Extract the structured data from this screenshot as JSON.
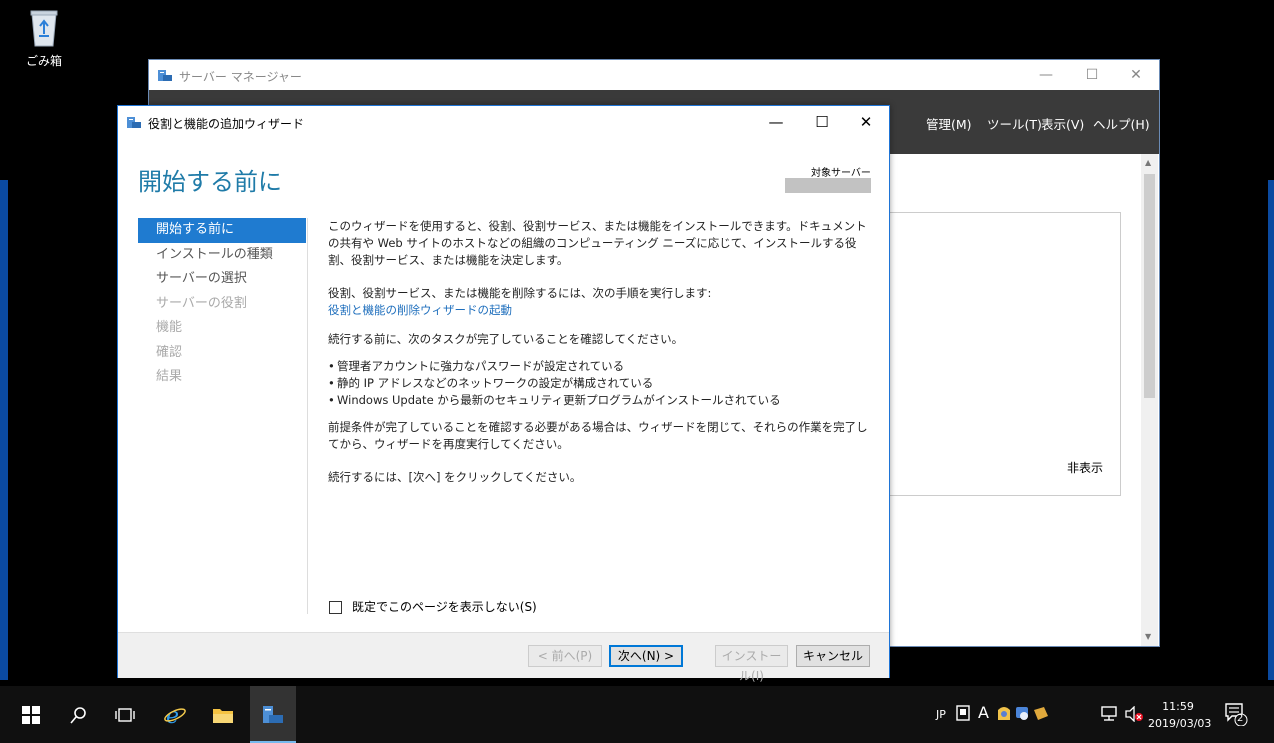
{
  "desktop": {
    "recycle_bin_label": "ごみ箱"
  },
  "server_manager": {
    "title": "サーバー マネージャー",
    "menus": [
      "管理(M)",
      "ツール(T)",
      "表示(V)",
      "ヘルプ(H)"
    ],
    "hide_label": "非表示"
  },
  "wizard": {
    "title": "役割と機能の追加ウィザード",
    "heading": "開始する前に",
    "destination_label": "対象サーバー",
    "nav": [
      "開始する前に",
      "インストールの種類",
      "サーバーの選択",
      "サーバーの役割",
      "機能",
      "確認",
      "結果"
    ],
    "intro": "このウィザードを使用すると、役割、役割サービス、または機能をインストールできます。ドキュメントの共有や Web サイトのホストなどの組織のコンピューティング ニーズに応じて、インストールする役割、役割サービス、または機能を決定します。",
    "remove_text": "役割、役割サービス、または機能を削除するには、次の手順を実行します:",
    "remove_link": "役割と機能の削除ウィザードの起動",
    "before_text": "続行する前に、次のタスクが完了していることを確認してください。",
    "tasks": [
      "管理者アカウントに強力なパスワードが設定されている",
      "静的 IP アドレスなどのネットワークの設定が構成されている",
      "Windows Update から最新のセキュリティ更新プログラムがインストールされている"
    ],
    "prereq_text": "前提条件が完了していることを確認する必要がある場合は、ウィザードを閉じて、それらの作業を完了してから、ウィザードを再度実行してください。",
    "continue_text": "続行するには、[次へ] をクリックしてください。",
    "skip_checkbox_label": "既定でこのページを表示しない(S)",
    "buttons": {
      "prev": "< 前へ(P)",
      "next": "次へ(N) >",
      "install": "インストール(I)",
      "cancel": "キャンセル"
    }
  },
  "taskbar": {
    "ime": "JP",
    "ime_mode": "A",
    "time": "11:59",
    "date": "2019/03/03",
    "notification_count": "2"
  },
  "colors": {
    "accent": "#1f7bd0",
    "heading": "#1f7ba8",
    "link": "#1f6fbd"
  }
}
